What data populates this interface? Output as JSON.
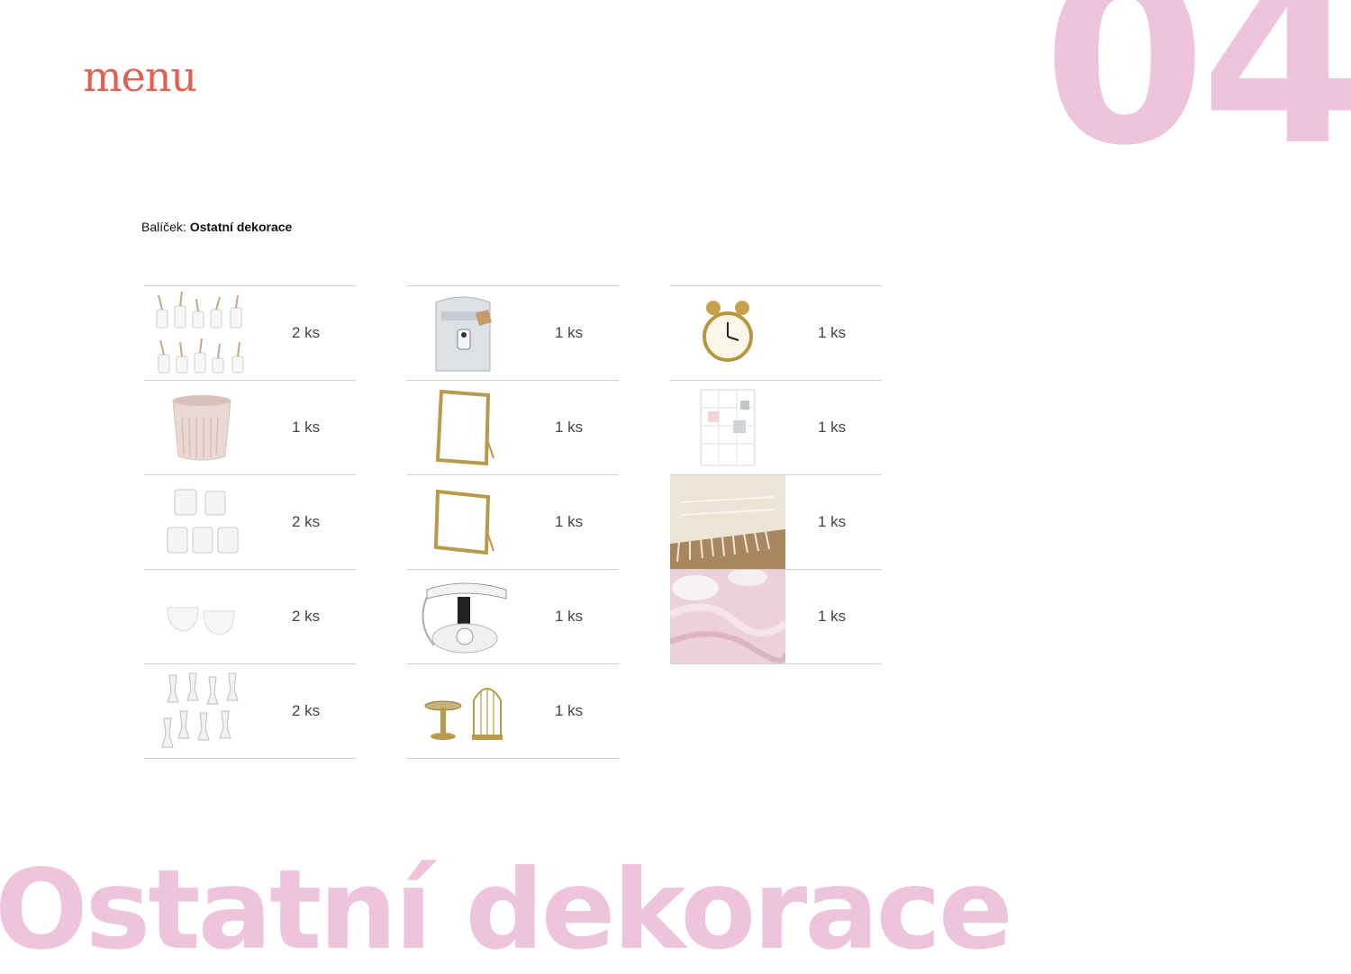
{
  "brand": {
    "logo_text": "menu"
  },
  "page_number": "04",
  "package": {
    "label": "Balíček:",
    "name": "Ostatní dekorace"
  },
  "section_title": "Ostatní dekorace",
  "columns": [
    {
      "items": [
        {
          "image": "glass-vases-with-dried-flowers",
          "quantity": "2 ks"
        },
        {
          "image": "ribbed-pink-ceramic-pot",
          "quantity": "1 ks"
        },
        {
          "image": "glass-votive-holders",
          "quantity": "2 ks"
        },
        {
          "image": "white-ceramic-bowls",
          "quantity": "2 ks"
        },
        {
          "image": "glass-candlesticks",
          "quantity": "2 ks"
        }
      ]
    },
    {
      "items": [
        {
          "image": "silver-post-box",
          "quantity": "1 ks"
        },
        {
          "image": "gold-frame-mirror",
          "quantity": "1 ks"
        },
        {
          "image": "gold-frame-square",
          "quantity": "1 ks"
        },
        {
          "image": "retro-white-telephone",
          "quantity": "1 ks"
        },
        {
          "image": "gold-cake-stand-and-birdcage",
          "quantity": "1 ks"
        }
      ]
    },
    {
      "items": [
        {
          "image": "gold-alarm-clock",
          "quantity": "1 ks"
        },
        {
          "image": "wire-memo-board",
          "quantity": "1 ks"
        },
        {
          "image": "crochet-table-runner",
          "quantity": "1 ks"
        },
        {
          "image": "pink-chiffon-fabric",
          "quantity": "1 ks"
        }
      ]
    }
  ]
}
